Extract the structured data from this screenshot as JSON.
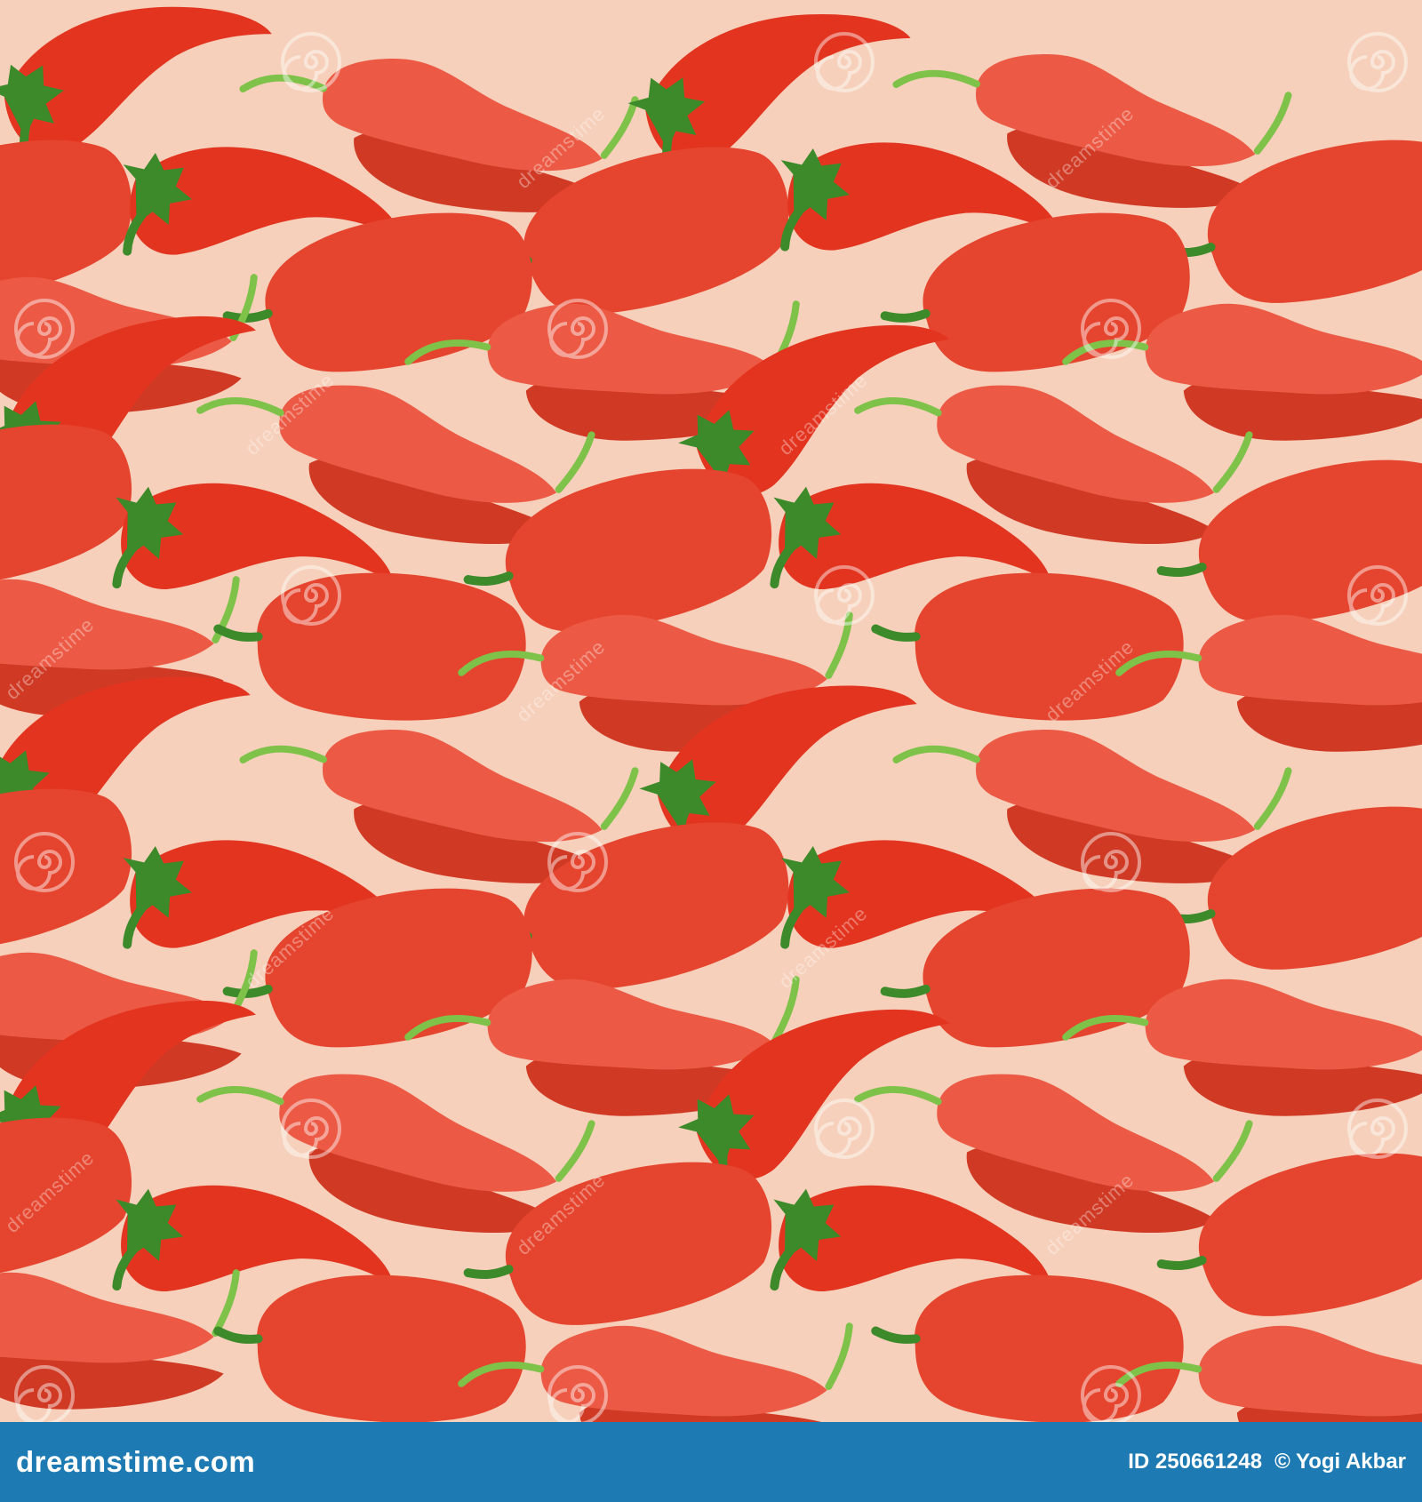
{
  "pattern": {
    "background": "#f6d0bb",
    "palette": {
      "chili": "#e2341f",
      "bell": "#e5452e",
      "pale_pepper": "#ec5a45",
      "pepper_shadow": "#d03a25",
      "stem_light": "#7fc24a",
      "stem_dark": "#3d8a2a"
    },
    "motifs": [
      "chili-pepper",
      "bell-pepper",
      "pale-pepper-with-shadow"
    ]
  },
  "watermark": {
    "text": "dreamstime",
    "icon": "spiral-icon"
  },
  "footer": {
    "background": "#1d7ab2",
    "brand": "dreamstime.com",
    "image_id": "ID 250661248",
    "author": "© Yogi Akbar"
  }
}
